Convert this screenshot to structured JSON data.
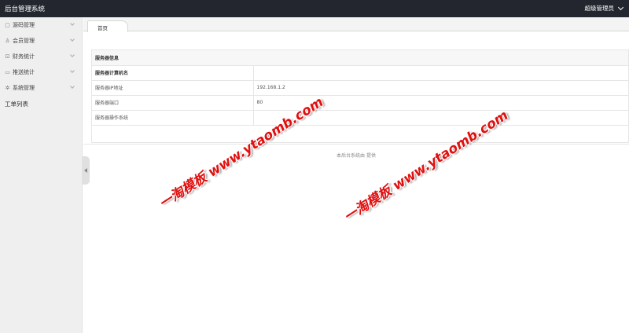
{
  "header": {
    "app_title": "后台管理系统",
    "user_label": "超级管理员"
  },
  "sidebar": {
    "items": [
      {
        "label": "源码管理",
        "icon": "package-icon"
      },
      {
        "label": "会员管理",
        "icon": "user-icon"
      },
      {
        "label": "财务统计",
        "icon": "money-icon"
      },
      {
        "label": "推送统计",
        "icon": "push-icon"
      },
      {
        "label": "系统管理",
        "icon": "gear-icon"
      }
    ],
    "plain_item": "工单列表"
  },
  "tabs": [
    {
      "label": "首页"
    }
  ],
  "server_panel": {
    "heading": "服务器信息",
    "rows": [
      {
        "key": "服务器计算机名",
        "value": ""
      },
      {
        "key": "服务器IP地址",
        "value": "192.168.1.2"
      },
      {
        "key": "服务器端口",
        "value": "80"
      },
      {
        "key": "服务器操作系统",
        "value": ""
      }
    ]
  },
  "footer": {
    "text": "本后台系统由 提供"
  },
  "watermarks": [
    {
      "text": "一淘模板 www.ytaomb.com"
    },
    {
      "text": "一淘模板 www.ytaomb.com"
    }
  ],
  "colors": {
    "topbar": "#23262e",
    "sidebar": "#efefef",
    "watermark": "#e01010"
  }
}
